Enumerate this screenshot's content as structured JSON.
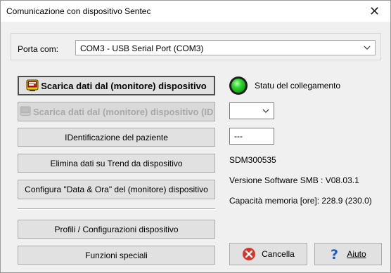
{
  "window": {
    "title": "Comunicazione con dispositivo Sentec",
    "close_glyph": "✕"
  },
  "port": {
    "label": "Porta com:",
    "selected": "COM3 - USB Serial Port (COM3)"
  },
  "buttons": {
    "download": "Scarica dati dal (monitore) dispositivo",
    "download_disabled": "Scarica dati dal (monitore) dispositivo (ID",
    "patient_id": "IDentificazione del paziente",
    "delete_trend": "Elimina dati su Trend da dispositivo",
    "configure_datetime": "Configura \"Data & Ora\" del (monitore) dispositivo",
    "profiles": "Profili / Configurazioni dispositivo",
    "special": "Funzioni speciali",
    "cancel": "Cancella",
    "help": "Aiuto"
  },
  "status": {
    "connection_label": "Statu del collegamento",
    "led_color": "#2fd62f",
    "id_select_value": "",
    "id_box_value": "---",
    "serial": "SDM300535",
    "software_version": "Versione Software SMB : V08.03.1",
    "memory_capacity": "Capacità memoria [ore]: 228.9 (230.0)"
  },
  "icons": [
    "monitor-download-icon",
    "cancel-icon",
    "help-icon",
    "chevron-down-icon",
    "close-icon"
  ]
}
